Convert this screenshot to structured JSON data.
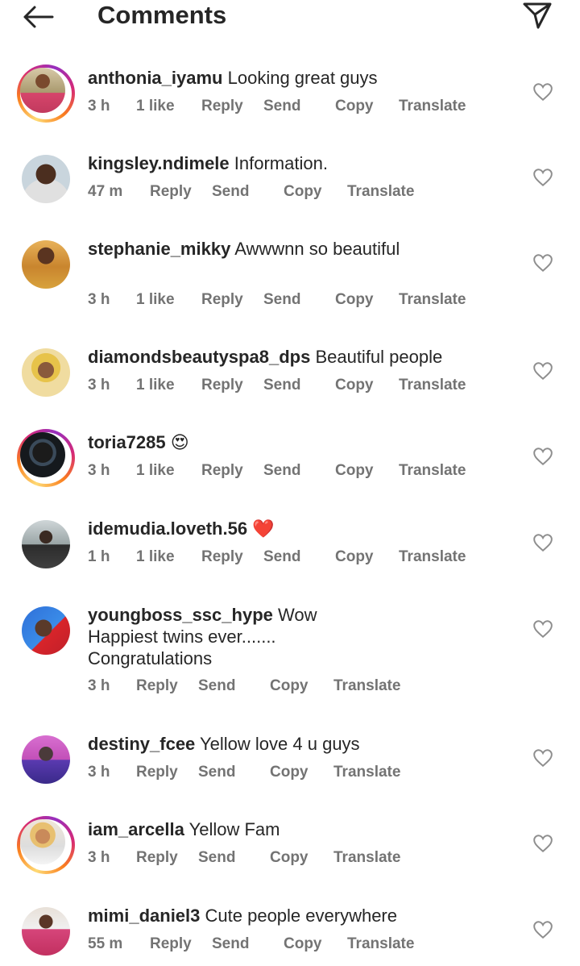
{
  "header": {
    "title": "Comments",
    "back_icon": "back-arrow-icon",
    "send_icon": "paper-plane-icon"
  },
  "action_labels": {
    "reply": "Reply",
    "send": "Send",
    "copy": "Copy",
    "translate": "Translate"
  },
  "colors": {
    "story_ring": [
      "#feda75",
      "#fa7e1e",
      "#d62976",
      "#962fbf"
    ],
    "meta_text": "#737373",
    "body_text": "#262626"
  },
  "comments": [
    {
      "username": "anthonia_iyamu",
      "text": "Looking great guys",
      "time": "3 h",
      "likes": "1 like",
      "ring": true
    },
    {
      "username": "kingsley.ndimele",
      "text": "Information.",
      "time": "47 m",
      "likes": "",
      "ring": false
    },
    {
      "username": "stephanie_mikky",
      "text": "Awwwnn so beautiful",
      "time": "3 h",
      "likes": "1 like",
      "ring": false
    },
    {
      "username": "diamondsbeautyspa8_dps",
      "text": "Beautiful people",
      "time": "3 h",
      "likes": "1 like",
      "ring": false
    },
    {
      "username": "toria7285",
      "text": "😍",
      "time": "3 h",
      "likes": "1 like",
      "ring": true
    },
    {
      "username": "idemudia.loveth.56",
      "text": "❤️",
      "time": "1 h",
      "likes": "1 like",
      "ring": false
    },
    {
      "username": "youngboss_ssc_hype",
      "text": "Wow",
      "text_line2": "Happiest twins ever.......",
      "text_line3": "Congratulations",
      "time": "3 h",
      "likes": "",
      "ring": false
    },
    {
      "username": "destiny_fcee",
      "text": "Yellow love 4 u guys",
      "time": "3 h",
      "likes": "",
      "ring": false
    },
    {
      "username": "iam_arcella",
      "text": "Yellow Fam",
      "time": "3 h",
      "likes": "",
      "ring": true
    },
    {
      "username": "mimi_daniel3",
      "text": "Cute people everywhere",
      "time": "55 m",
      "likes": "",
      "ring": false
    }
  ]
}
